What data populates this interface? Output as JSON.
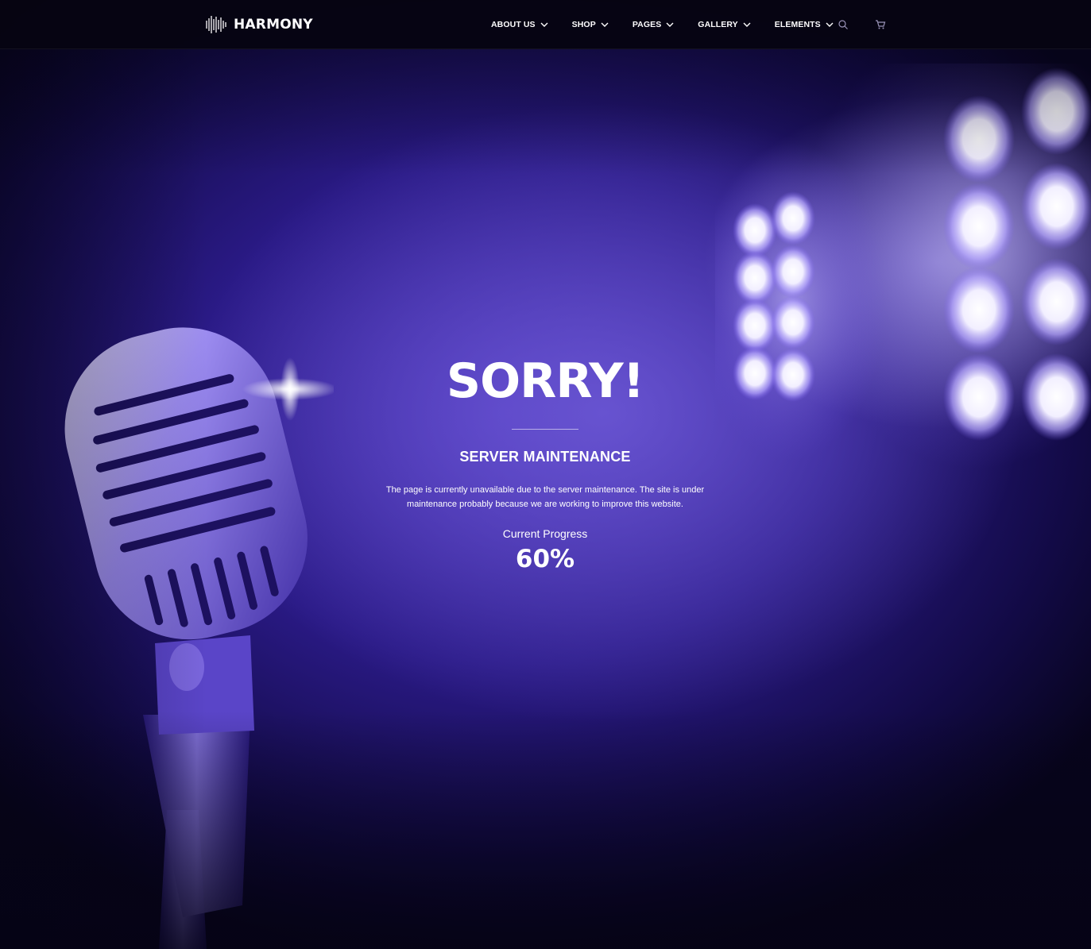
{
  "brand": {
    "name": "HARMONY"
  },
  "nav": {
    "items": [
      {
        "label": "ABOUT US"
      },
      {
        "label": "SHOP"
      },
      {
        "label": "PAGES"
      },
      {
        "label": "GALLERY"
      },
      {
        "label": "ELEMENTS"
      }
    ],
    "icons": [
      "search-icon",
      "cart-icon"
    ]
  },
  "maintenance": {
    "title": "SORRY!",
    "subtitle": "SERVER MAINTENANCE",
    "description": "The page is currently unavailable due to the server maintenance. The site is under maintenance probably because we are working to improve this website.",
    "progress_label": "Current Progress",
    "progress_value": "60%"
  },
  "colors": {
    "header_bg": "#06040f",
    "accent_purple": "#4a33b8",
    "text": "#ffffff"
  }
}
